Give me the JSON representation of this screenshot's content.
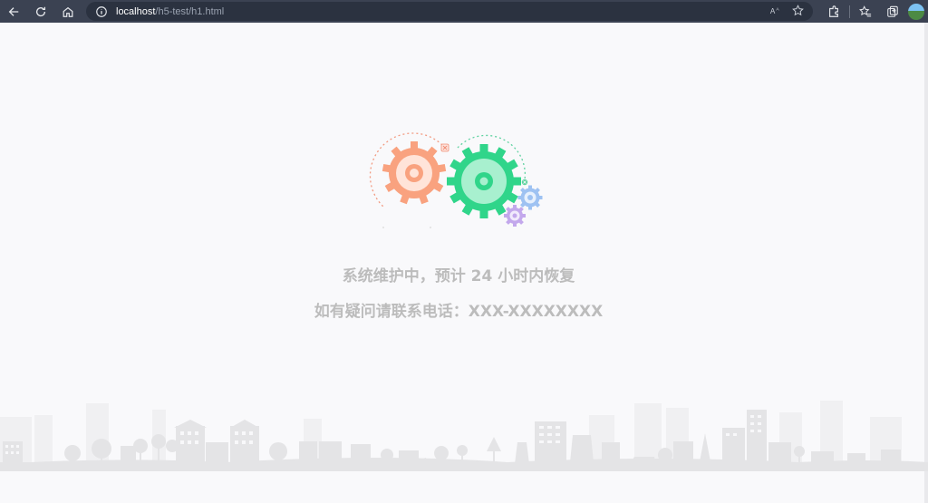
{
  "browser": {
    "url_host": "localhost",
    "url_path": "/h5-test/h1.html",
    "reader_mode_label": "Aᴬ"
  },
  "page": {
    "message_line1": "系统维护中，预计 24 小时内恢复",
    "message_line2": "如有疑问请联系电话：XXX-XXXXXXXX"
  },
  "colors": {
    "gear_orange": "#f9a27f",
    "gear_green": "#30d58a",
    "gear_blue": "#9ec2f2",
    "gear_purple": "#c3a8ec",
    "message_text": "#bcbcbc",
    "skyline": "#e6e6e8"
  },
  "icons": [
    "back-icon",
    "reload-icon",
    "home-icon",
    "info-icon",
    "read-aloud-icon",
    "add-favorite-icon",
    "extensions-icon",
    "favorites-icon",
    "collections-icon"
  ]
}
